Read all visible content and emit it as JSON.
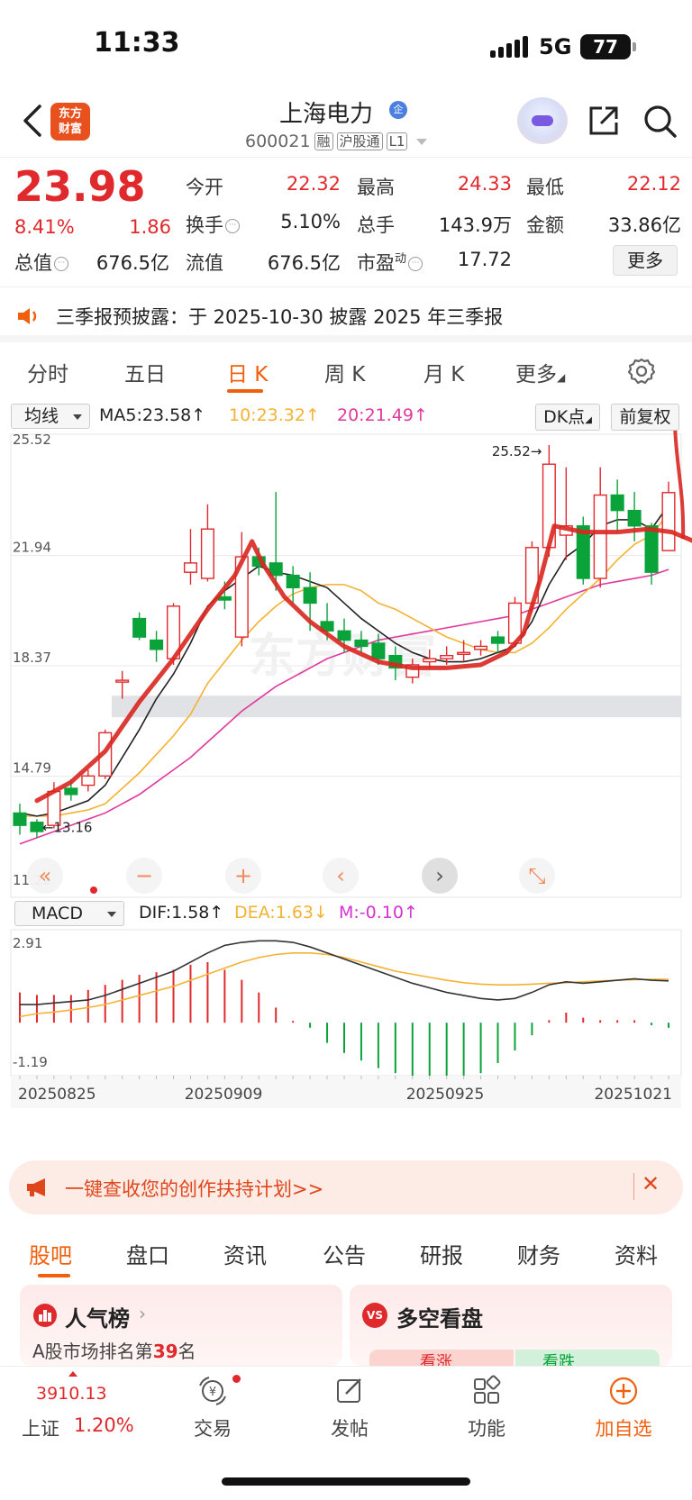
{
  "status": {
    "time": "11:33",
    "network": "5G",
    "battery": "77"
  },
  "header": {
    "logo_line1": "东方",
    "logo_line2": "财富",
    "stock_name": "上海电力",
    "name_badge": "企",
    "code": "600021",
    "tags": [
      "融",
      "沪股通",
      "L1"
    ]
  },
  "quote": {
    "price": "23.98",
    "change_pct": "8.41%",
    "change": "1.86",
    "stats": [
      {
        "label": "今开",
        "value": "22.32"
      },
      {
        "label": "最高",
        "value": "24.33"
      },
      {
        "label": "最低",
        "value": "22.12"
      },
      {
        "label": "换手",
        "value": "5.10%"
      },
      {
        "label": "总手",
        "value": "143.9万"
      },
      {
        "label": "金额",
        "value": "33.86亿"
      },
      {
        "label": "总值",
        "value": "676.5亿"
      },
      {
        "label": "流值",
        "value": "676.5亿"
      },
      {
        "label": "市盈",
        "sup": "动",
        "value": "17.72"
      }
    ],
    "more_label": "更多"
  },
  "notice": "三季报预披露：于 2025-10-30 披露 2025 年三季报",
  "period_tabs": [
    "分时",
    "五日",
    "日 K",
    "周 K",
    "月 K",
    "更多"
  ],
  "active_period": "日 K",
  "ma": {
    "select_label": "均线",
    "ma5": "MA5:23.58",
    "ma10": "10:23.32",
    "ma20": "20:21.49",
    "dk_label": "DK点",
    "adjust_label": "前复权"
  },
  "watermark": "东方财富",
  "colors": {
    "up": "#e0292c",
    "down": "#0aa33a",
    "ma5": "#222222",
    "ma10": "#f5b132",
    "ma20": "#e0399c",
    "accent": "#f0600c"
  },
  "chart_data": [
    {
      "type": "candlestick",
      "y_ticks": [
        "25.52",
        "21.94",
        "18.37",
        "14.79",
        "11.22"
      ],
      "ylim": [
        11.22,
        25.52
      ],
      "max_label": "25.52",
      "min_label": "13.16",
      "candles": [
        {
          "o": 13.6,
          "c": 13.2,
          "h": 13.9,
          "l": 12.9
        },
        {
          "o": 13.3,
          "c": 13.0,
          "h": 13.4,
          "l": 12.8
        },
        {
          "o": 13.2,
          "c": 14.3,
          "h": 14.6,
          "l": 13.1
        },
        {
          "o": 14.4,
          "c": 14.2,
          "h": 14.7,
          "l": 14.0
        },
        {
          "o": 14.5,
          "c": 14.8,
          "h": 15.0,
          "l": 14.3
        },
        {
          "o": 14.8,
          "c": 16.2,
          "h": 16.3,
          "l": 14.7
        },
        {
          "o": 17.9,
          "c": 17.9,
          "h": 18.2,
          "l": 17.3
        },
        {
          "o": 19.9,
          "c": 19.3,
          "h": 20.1,
          "l": 19.2
        },
        {
          "o": 19.2,
          "c": 18.9,
          "h": 19.5,
          "l": 18.5
        },
        {
          "o": 18.6,
          "c": 20.3,
          "h": 20.4,
          "l": 18.4
        },
        {
          "o": 21.4,
          "c": 21.7,
          "h": 22.8,
          "l": 21.0
        },
        {
          "o": 21.2,
          "c": 22.8,
          "h": 23.6,
          "l": 21.1
        },
        {
          "o": 20.6,
          "c": 20.5,
          "h": 21.1,
          "l": 20.2
        },
        {
          "o": 19.3,
          "c": 21.9,
          "h": 22.7,
          "l": 19.0
        },
        {
          "o": 21.9,
          "c": 21.6,
          "h": 22.2,
          "l": 21.3
        },
        {
          "o": 21.7,
          "c": 21.3,
          "h": 24.0,
          "l": 20.8
        },
        {
          "o": 21.3,
          "c": 20.9,
          "h": 21.6,
          "l": 20.4
        },
        {
          "o": 20.9,
          "c": 20.4,
          "h": 21.4,
          "l": 19.5
        },
        {
          "o": 19.8,
          "c": 19.5,
          "h": 20.4,
          "l": 19.2
        },
        {
          "o": 19.5,
          "c": 19.2,
          "h": 19.9,
          "l": 18.8
        },
        {
          "o": 19.2,
          "c": 19.0,
          "h": 19.5,
          "l": 18.8
        },
        {
          "o": 19.1,
          "c": 18.6,
          "h": 19.4,
          "l": 18.4
        },
        {
          "o": 18.7,
          "c": 18.3,
          "h": 19.0,
          "l": 17.9
        },
        {
          "o": 18.0,
          "c": 18.4,
          "h": 18.6,
          "l": 17.8
        },
        {
          "o": 18.5,
          "c": 18.6,
          "h": 18.9,
          "l": 18.3
        },
        {
          "o": 18.6,
          "c": 18.7,
          "h": 19.0,
          "l": 18.4
        },
        {
          "o": 18.8,
          "c": 18.8,
          "h": 19.2,
          "l": 18.5
        },
        {
          "o": 18.9,
          "c": 19.0,
          "h": 19.2,
          "l": 18.7
        },
        {
          "o": 19.3,
          "c": 19.1,
          "h": 19.5,
          "l": 18.8
        },
        {
          "o": 19.1,
          "c": 20.4,
          "h": 20.6,
          "l": 19.0
        },
        {
          "o": 20.4,
          "c": 22.2,
          "h": 22.4,
          "l": 20.1
        },
        {
          "o": 22.2,
          "c": 24.9,
          "h": 25.52,
          "l": 21.9
        },
        {
          "o": 22.6,
          "c": 22.9,
          "h": 24.8,
          "l": 21.8
        },
        {
          "o": 22.9,
          "c": 21.2,
          "h": 23.2,
          "l": 21.0
        },
        {
          "o": 21.2,
          "c": 23.9,
          "h": 24.8,
          "l": 20.9
        },
        {
          "o": 23.9,
          "c": 23.4,
          "h": 24.4,
          "l": 22.7
        },
        {
          "o": 23.4,
          "c": 22.9,
          "h": 24.0,
          "l": 22.4
        },
        {
          "o": 22.9,
          "c": 21.4,
          "h": 23.0,
          "l": 21.0
        },
        {
          "o": 22.1,
          "c": 23.98,
          "h": 24.33,
          "l": 22.12
        }
      ],
      "ma5": [
        13.6,
        13.5,
        13.6,
        13.8,
        14.0,
        14.5,
        15.4,
        16.3,
        17.3,
        18.1,
        19.1,
        20.3,
        20.8,
        21.2,
        21.6,
        21.4,
        21.3,
        21.1,
        20.9,
        20.4,
        19.9,
        19.5,
        19.1,
        18.8,
        18.6,
        18.5,
        18.5,
        18.6,
        18.8,
        19.0,
        19.8,
        21.0,
        21.9,
        22.3,
        22.9,
        23.1,
        23.1,
        22.8,
        23.58
      ],
      "ma10": [
        13.5,
        13.5,
        13.5,
        13.6,
        13.7,
        13.9,
        14.4,
        14.9,
        15.5,
        16.1,
        16.8,
        17.8,
        18.5,
        19.2,
        19.8,
        20.3,
        20.7,
        20.9,
        21.0,
        21.0,
        20.8,
        20.4,
        20.2,
        19.9,
        19.6,
        19.3,
        19.1,
        18.9,
        18.8,
        18.8,
        19.1,
        19.6,
        20.2,
        20.7,
        21.2,
        21.8,
        22.3,
        22.6,
        23.32
      ],
      "ma20": [
        12.6,
        12.8,
        13.0,
        13.2,
        13.4,
        13.6,
        13.9,
        14.2,
        14.6,
        15.0,
        15.4,
        15.9,
        16.4,
        16.9,
        17.3,
        17.7,
        18.0,
        18.3,
        18.6,
        18.8,
        19.0,
        19.2,
        19.3,
        19.4,
        19.5,
        19.6,
        19.7,
        19.8,
        19.9,
        20.0,
        20.2,
        20.4,
        20.6,
        20.8,
        21.0,
        21.1,
        21.2,
        21.3,
        21.49
      ]
    },
    {
      "type": "bar",
      "indicator": "MACD",
      "select_label": "MACD",
      "dif_label": "DIF:1.58",
      "dea_label": "DEA:1.63",
      "m_label": "M:-0.10",
      "y_ticks": [
        "2.91",
        "-1.19"
      ],
      "ylim": [
        -1.19,
        2.91
      ],
      "x_labels": [
        "20250825",
        "20250909",
        "20250925",
        "20251021"
      ],
      "dif": [
        0.8,
        0.8,
        0.85,
        0.9,
        0.95,
        1.1,
        1.3,
        1.5,
        1.7,
        1.9,
        2.2,
        2.5,
        2.75,
        2.85,
        2.9,
        2.9,
        2.85,
        2.7,
        2.5,
        2.3,
        2.1,
        1.9,
        1.7,
        1.5,
        1.35,
        1.2,
        1.1,
        1.0,
        0.95,
        1.0,
        1.2,
        1.45,
        1.55,
        1.5,
        1.55,
        1.6,
        1.65,
        1.6,
        1.58
      ],
      "dea": [
        0.4,
        0.5,
        0.55,
        0.62,
        0.7,
        0.8,
        0.95,
        1.1,
        1.25,
        1.4,
        1.6,
        1.8,
        2.0,
        2.2,
        2.35,
        2.45,
        2.5,
        2.5,
        2.45,
        2.35,
        2.2,
        2.05,
        1.9,
        1.8,
        1.7,
        1.6,
        1.52,
        1.47,
        1.45,
        1.45,
        1.47,
        1.5,
        1.52,
        1.55,
        1.58,
        1.6,
        1.62,
        1.63,
        1.63
      ],
      "m": [
        0.6,
        0.55,
        0.55,
        0.55,
        0.65,
        0.75,
        0.85,
        0.95,
        1.0,
        1.05,
        1.15,
        1.2,
        1.05,
        0.85,
        0.6,
        0.3,
        0.0,
        -0.1,
        -0.4,
        -0.6,
        -0.75,
        -0.9,
        -1.0,
        -1.05,
        -1.1,
        -1.19,
        -1.1,
        -1.0,
        -0.8,
        -0.55,
        -0.25,
        0.05,
        0.2,
        0.1,
        0.05,
        0.05,
        0.05,
        -0.05,
        -0.1
      ]
    }
  ],
  "promo": {
    "text": "一键查收您的创作扶持计划>>"
  },
  "bottom_tabs": [
    "股吧",
    "盘口",
    "资讯",
    "公告",
    "研报",
    "财务",
    "资料"
  ],
  "cards": {
    "left_title": "人气榜",
    "left_sub_prefix": "A股市场排名第",
    "left_rank": "39",
    "left_sub_suffix": "名",
    "right_title": "多空看盘",
    "right_badge": "VS",
    "bull": "看涨",
    "bear": "看跌"
  },
  "nav": {
    "index_value": "3910.13",
    "index_name": "上证",
    "index_change": "1.20%",
    "trade": "交易",
    "post": "发帖",
    "func": "功能",
    "watch": "加自选"
  }
}
